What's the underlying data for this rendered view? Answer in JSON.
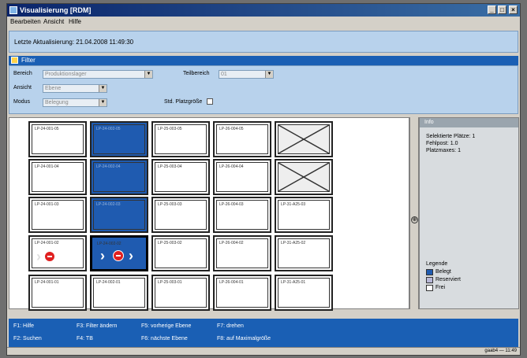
{
  "window": {
    "title": "Visualisierung [RDM]"
  },
  "menu": [
    "Bearbeiten",
    "Ansicht",
    "Hilfe"
  ],
  "info": {
    "last_update_label": "Letzte Aktualisierung:",
    "last_update_value": "21.04.2008 11:49:30"
  },
  "filter": {
    "header": "Filter",
    "bereich_label": "Bereich",
    "bereich_value": "Produktionslager",
    "teilbereich_label": "Teilbereich",
    "teilbereich_value": "01",
    "ansicht_label": "Ansicht",
    "ansicht_value": "Ebene",
    "modus_label": "Modus",
    "modus_value": "Belegung",
    "platzgroesse_label": "Std. Platzgröße"
  },
  "grid": {
    "rows": [
      [
        {
          "label": "LP-24-001-05",
          "state": "free"
        },
        {
          "label": "LP-24-002-05",
          "state": "occupied"
        },
        {
          "label": "LP-25-003-05",
          "state": "free"
        },
        {
          "label": "LP-26-004-05",
          "state": "free"
        },
        {
          "label": "",
          "state": "unavailable"
        }
      ],
      [
        {
          "label": "LP-24-001-04",
          "state": "free"
        },
        {
          "label": "LP-24-002-04",
          "state": "occupied"
        },
        {
          "label": "LP-25-003-04",
          "state": "free"
        },
        {
          "label": "LP-26-004-04",
          "state": "free"
        },
        {
          "label": "",
          "state": "unavailable"
        }
      ],
      [
        {
          "label": "LP-24-001-03",
          "state": "free"
        },
        {
          "label": "LP-24-002-03",
          "state": "occupied"
        },
        {
          "label": "LP-25-003-03",
          "state": "free"
        },
        {
          "label": "LP-26-004-03",
          "state": "free"
        },
        {
          "label": "LP-31-A25-03",
          "state": "free"
        }
      ],
      [
        {
          "label": "LP-24-001-02",
          "state": "blocked"
        },
        {
          "label": "LP-24-002-02",
          "state": "selected"
        },
        {
          "label": "LP-25-003-02",
          "state": "free"
        },
        {
          "label": "LP-26-004-02",
          "state": "free"
        },
        {
          "label": "LP-31-A25-02",
          "state": "free"
        }
      ],
      [
        {
          "label": "LP-24-001-01",
          "state": "free"
        },
        {
          "label": "LP-24-002-01",
          "state": "free"
        },
        {
          "label": "LP-25-003-01",
          "state": "free"
        },
        {
          "label": "LP-26-004-01",
          "state": "free"
        },
        {
          "label": "LP-31-A25-01",
          "state": "free"
        }
      ]
    ]
  },
  "infopanel": {
    "header": "Info",
    "lines": [
      "Selektierte Plätze: 1",
      "Fehlpost: 1.0",
      "Platzmaxes: 1"
    ],
    "legend_title": "Legende",
    "legend": [
      {
        "label": "Belegt",
        "color": "#1f5bb0"
      },
      {
        "label": "Reserviert",
        "color": "#b8b8d8"
      },
      {
        "label": "Frei",
        "color": "#ffffff"
      }
    ]
  },
  "fkeys": [
    {
      "key": "F1",
      "label": "F1: Hilfe"
    },
    {
      "key": "F2",
      "label": "F2: Suchen"
    },
    {
      "key": "F3",
      "label": "F3: Filter ändern"
    },
    {
      "key": "F4",
      "label": "F4: TB"
    },
    {
      "key": "F5",
      "label": "F5: vorherige Ebene"
    },
    {
      "key": "F6",
      "label": "F6: nächste Ebene"
    },
    {
      "key": "F7",
      "label": "F7: drehen"
    },
    {
      "key": "F8",
      "label": "F8: auf Maximalgröße"
    }
  ],
  "status": {
    "right": "gaab4 — 11:49"
  }
}
